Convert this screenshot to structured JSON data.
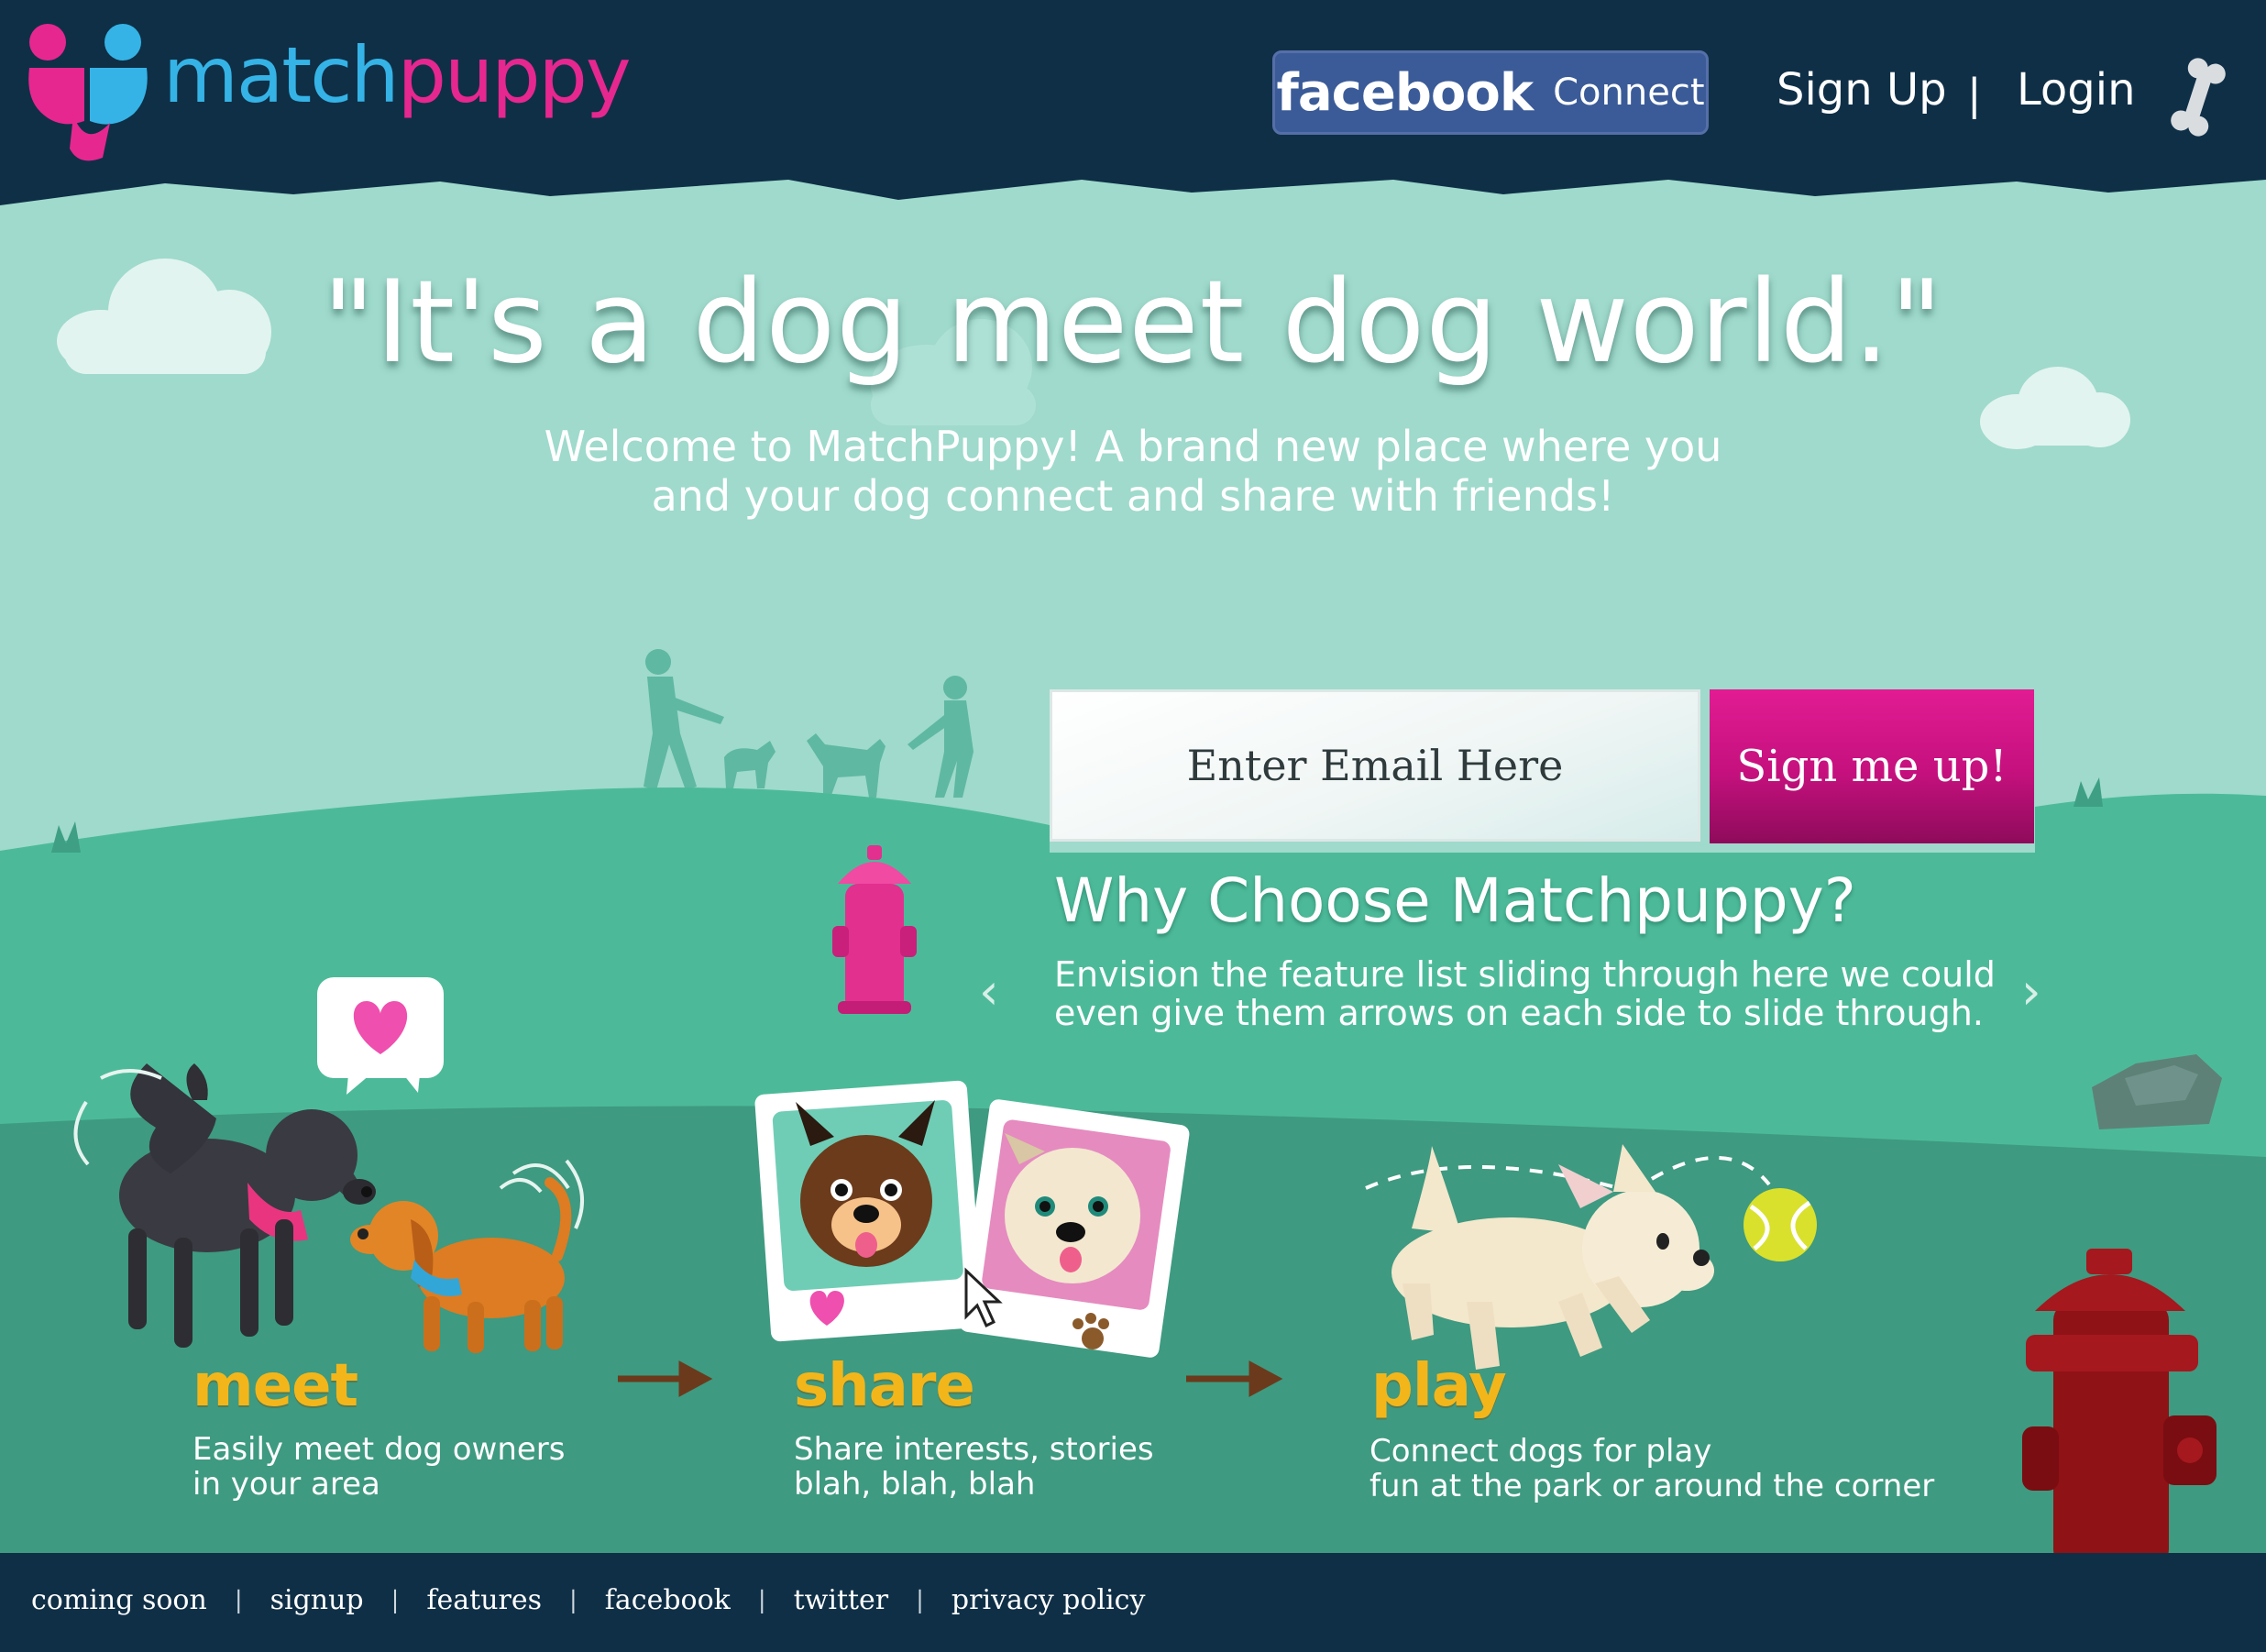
{
  "header": {
    "logo_part1": "match",
    "logo_part2": "puppy",
    "facebook_word": "facebook",
    "facebook_connect": "Connect",
    "signup_link": "Sign Up",
    "separator": "|",
    "login_link": "Login"
  },
  "hero": {
    "headline": "\"It's a dog meet dog world.\"",
    "welcome_line1": "Welcome to MatchPuppy!  A brand new place where you",
    "welcome_line2": "and your dog connect and share with friends!"
  },
  "signup_form": {
    "email_placeholder": "Enter Email Here",
    "submit_label": "Sign me up!"
  },
  "why": {
    "title": "Why Choose Matchpuppy?",
    "desc_line1": "Envision the feature list sliding through here we could",
    "desc_line2": "even give them arrows on each side to slide through.",
    "prev_arrow": "‹",
    "next_arrow": "›"
  },
  "steps": [
    {
      "title": "meet",
      "line1": "Easily meet dog owners",
      "line2": "in your area"
    },
    {
      "title": "share",
      "line1": "Share interests, stories",
      "line2": "blah, blah, blah"
    },
    {
      "title": "play",
      "line1": "Connect dogs for play",
      "line2": "fun at the park or around the corner"
    }
  ],
  "footer": {
    "links": [
      "coming soon",
      "signup",
      "features",
      "facebook",
      "twitter",
      "privacy policy"
    ],
    "separator": "|"
  },
  "colors": {
    "header_bg": "#0f2f47",
    "sky": "#9fdacc",
    "hill_light": "#4cba99",
    "hill_dark": "#3e9a80",
    "accent_pink": "#e21c93",
    "accent_blue": "#35b3e6",
    "step_title": "#f3b61a",
    "facebook_blue": "#3b5b98"
  },
  "icons": [
    "matchpuppy-logo-icon",
    "bone-icon",
    "cloud-icon",
    "fire-hydrant-icon",
    "heart-icon",
    "cursor-icon",
    "tennis-ball-icon",
    "paw-icon"
  ]
}
